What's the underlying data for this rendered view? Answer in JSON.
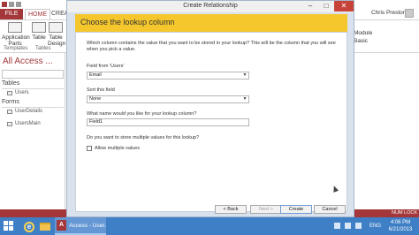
{
  "access": {
    "tabs": [
      "FILE",
      "HOME",
      "CREATE"
    ],
    "user_name": "Chris Preston",
    "ribbon_buttons": [
      "Application Parts",
      "Table",
      "Table Design"
    ],
    "ribbon_groups": [
      "Templates",
      "Tables"
    ],
    "right_items": [
      "Module",
      "Basic"
    ],
    "nav_title": "All Access ...",
    "nav_sections": [
      "Tables",
      "Forms"
    ],
    "nav_tables": [
      "Users"
    ],
    "nav_forms": [
      "UserDetails",
      "UsersMain"
    ],
    "status_num_lock": "NUM LOCK"
  },
  "dialog": {
    "title": "Create Relationship",
    "window_controls": {
      "minimize": "–",
      "maximize": "□",
      "close": "✕"
    },
    "step_title": "Choose the lookup column",
    "intro_text": "Which column contains the value that you want to be stored in your lookup? This will be the column that you will see when you pick a value.",
    "field_from_label": "Field from 'Users'",
    "field_from_value": "Email",
    "sort_label": "Sort this field",
    "sort_value": "None",
    "name_question": "What name would you like for your lookup column?",
    "name_value": "Field1",
    "multi_question": "Do you want to store multiple values for this lookup?",
    "allow_multiple_label": "Allow multiple values",
    "buttons": {
      "back": "< Back",
      "next": "Next >",
      "create": "Create",
      "cancel": "Cancel"
    }
  },
  "taskbar": {
    "access_task_label": "Access - User...",
    "language": "ENG",
    "time": "4:06 PM",
    "date": "6/21/2013"
  },
  "colors": {
    "access_brand": "#a4373a",
    "wizard_header": "#f5c72c",
    "taskbar": "#3f7fc6"
  }
}
